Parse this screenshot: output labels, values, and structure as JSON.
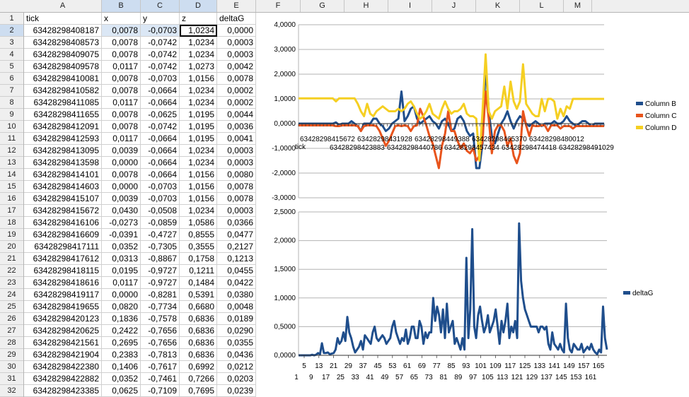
{
  "columns": [
    "A",
    "B",
    "C",
    "D",
    "E",
    "F",
    "G",
    "H",
    "I",
    "J",
    "K",
    "L",
    "M"
  ],
  "header_row": [
    "tick",
    "x",
    "y",
    "z",
    "deltaG"
  ],
  "rows": [
    [
      "63428298408187",
      "0,0078",
      "-0,0703",
      "1,0234",
      "0,0000"
    ],
    [
      "63428298408573",
      "0,0078",
      "-0,0742",
      "1,0234",
      "0,0003"
    ],
    [
      "63428298409075",
      "0,0078",
      "-0,0742",
      "1,0234",
      "0,0003"
    ],
    [
      "63428298409578",
      "0,0117",
      "-0,0742",
      "1,0273",
      "0,0042"
    ],
    [
      "63428298410081",
      "0,0078",
      "-0,0703",
      "1,0156",
      "0,0078"
    ],
    [
      "63428298410582",
      "0,0078",
      "-0,0664",
      "1,0234",
      "0,0002"
    ],
    [
      "63428298411085",
      "0,0117",
      "-0,0664",
      "1,0234",
      "0,0002"
    ],
    [
      "63428298411655",
      "0,0078",
      "-0,0625",
      "1,0195",
      "0,0044"
    ],
    [
      "63428298412091",
      "0,0078",
      "-0,0742",
      "1,0195",
      "0,0036"
    ],
    [
      "63428298412593",
      "0,0117",
      "-0,0664",
      "1,0195",
      "0,0041"
    ],
    [
      "63428298413095",
      "0,0039",
      "-0,0664",
      "1,0234",
      "0,0003"
    ],
    [
      "63428298413598",
      "0,0000",
      "-0,0664",
      "1,0234",
      "0,0003"
    ],
    [
      "63428298414101",
      "0,0078",
      "-0,0664",
      "1,0156",
      "0,0080"
    ],
    [
      "63428298414603",
      "0,0000",
      "-0,0703",
      "1,0156",
      "0,0078"
    ],
    [
      "63428298415107",
      "0,0039",
      "-0,0703",
      "1,0156",
      "0,0078"
    ],
    [
      "63428298415672",
      "0,0430",
      "-0,0508",
      "1,0234",
      "0,0003"
    ],
    [
      "63428298416106",
      "-0,0273",
      "-0,0859",
      "1,0586",
      "0,0366"
    ],
    [
      "63428298416609",
      "-0,0391",
      "-0,4727",
      "0,8555",
      "0,0477"
    ],
    [
      "63428298417111",
      "0,0352",
      "-0,7305",
      "0,3555",
      "0,2127"
    ],
    [
      "63428298417612",
      "0,0313",
      "-0,8867",
      "0,1758",
      "0,1213"
    ],
    [
      "63428298418115",
      "0,0195",
      "-0,9727",
      "0,1211",
      "0,0455"
    ],
    [
      "63428298418616",
      "0,0117",
      "-0,9727",
      "0,1484",
      "0,0422"
    ],
    [
      "63428298419117",
      "0,0000",
      "-0,8281",
      "0,5391",
      "0,0380"
    ],
    [
      "63428298419655",
      "0,0820",
      "-0,7734",
      "0,6680",
      "0,0048"
    ],
    [
      "63428298420123",
      "0,1836",
      "-0,7578",
      "0,6836",
      "0,0189"
    ],
    [
      "63428298420625",
      "0,2422",
      "-0,7656",
      "0,6836",
      "0,0290"
    ],
    [
      "63428298421561",
      "0,2695",
      "-0,7656",
      "0,6836",
      "0,0355"
    ],
    [
      "63428298421904",
      "0,2383",
      "-0,7813",
      "0,6836",
      "0,0436"
    ],
    [
      "63428298422380",
      "0,1406",
      "-0,7617",
      "0,6992",
      "0,0212"
    ],
    [
      "63428298422882",
      "0,0352",
      "-0,7461",
      "0,7266",
      "0,0203"
    ],
    [
      "63428298423385",
      "0,0625",
      "-0,7109",
      "0,7695",
      "0,0239"
    ]
  ],
  "chart_data": [
    {
      "type": "line",
      "ylim": [
        -3,
        4
      ],
      "yticks": [
        "4,0000",
        "3,0000",
        "2,0000",
        "1,0000",
        "0,0000",
        "-1,0000",
        "-2,0000",
        "-3,0000"
      ],
      "xlabel": "tick",
      "xticks_row1": [
        "63428298415672",
        "63428298431928",
        "63428298449388",
        "63428298465370",
        "63428298480012"
      ],
      "xticks_row2": [
        "63428298423883",
        "63428298440786",
        "63428298457434",
        "63428298474418",
        "63428298491029"
      ],
      "legend_position": "right",
      "series": [
        {
          "name": "Column B",
          "color": "#1f4e8c",
          "values": [
            0,
            0,
            0,
            0,
            0,
            0,
            0,
            0,
            0,
            0,
            0,
            0,
            0.05,
            -0.05,
            0,
            0,
            0,
            0.1,
            0,
            -0.1,
            -0.3,
            0,
            0,
            0,
            0.2,
            0.2,
            0,
            -0.1,
            -0.3,
            -0.2,
            0,
            0.1,
            0.2,
            1.3,
            0.1,
            0.3,
            0.6,
            0.7,
            0.2,
            0,
            0.1,
            0.2,
            0.3,
            0.1,
            0,
            -0.2,
            0.1,
            0.2,
            0,
            -0.3,
            -0.2,
            0.2,
            0.3,
            0.1,
            -0.3,
            -0.5,
            -0.4,
            -1.8,
            -1.8,
            -0.8,
            2.4,
            0.5,
            -0.5,
            -0.8,
            -0.4,
            0,
            0.2,
            0.5,
            0.1,
            -0.2,
            0.1,
            0.3,
            0.2,
            0,
            -0.1,
            0,
            0.1,
            0,
            -0.1,
            0,
            0,
            0,
            0.1,
            0,
            0,
            0.1,
            0.3,
            0.1,
            0,
            -0.1,
            0,
            0.1,
            0.1,
            0,
            -0.1,
            0,
            0,
            0,
            0
          ]
        },
        {
          "name": "Column C",
          "color": "#e8541c",
          "values": [
            -0.07,
            -0.07,
            -0.07,
            -0.07,
            -0.07,
            -0.07,
            -0.07,
            -0.07,
            -0.07,
            -0.07,
            -0.07,
            -0.07,
            -0.1,
            -0.1,
            -0.07,
            -0.07,
            -0.07,
            -0.07,
            -0.07,
            -0.1,
            -0.3,
            -0.1,
            -0.07,
            -0.07,
            -0.07,
            -0.1,
            -0.3,
            -0.6,
            -0.9,
            -0.7,
            -0.4,
            -0.1,
            -0.07,
            -0.1,
            -0.07,
            -0.1,
            -0.3,
            -0.1,
            -0.07,
            0.6,
            0.3,
            -0.07,
            -0.5,
            -0.8,
            -1.3,
            -1.8,
            -0.9,
            -0.4,
            0.5,
            -0.3,
            -0.3,
            -0.7,
            -1.0,
            -0.8,
            -1.1,
            -1.2,
            -1.0,
            -1.5,
            -1.3,
            -0.7,
            1.3,
            0.2,
            -1.2,
            -0.3,
            -0.07,
            -0.07,
            -0.3,
            -0.9,
            -0.6,
            -1.3,
            -1.6,
            -1.2,
            0.5,
            -0.07,
            -0.5,
            -0.07,
            -0.1,
            -0.1,
            -0.07,
            -0.07,
            -0.3,
            -0.07,
            -0.07,
            -0.07,
            -0.2,
            -0.1,
            -0.1,
            -0.1,
            -0.2,
            -0.1,
            -0.1,
            -0.1,
            -0.1,
            -0.1,
            -0.1,
            -0.1,
            -0.1,
            -0.1,
            -0.1
          ]
        },
        {
          "name": "Column D",
          "color": "#f5cf22",
          "values": [
            1.02,
            1.02,
            1.02,
            1.02,
            1.02,
            1.02,
            1.02,
            1.02,
            1.02,
            1.02,
            1.02,
            1.02,
            0.9,
            1.02,
            1.02,
            1.02,
            1.02,
            1.02,
            1.02,
            0.8,
            0.5,
            0.3,
            0.8,
            0.4,
            0.3,
            0.5,
            0.6,
            0.7,
            0.6,
            0.5,
            0.5,
            0.5,
            0.6,
            0.5,
            0.6,
            0.8,
            0.9,
            0.7,
            0.4,
            0.2,
            0.3,
            0.5,
            0.8,
            0.4,
            0.3,
            0.2,
            0.6,
            0.9,
            0.6,
            0.4,
            0.5,
            0.5,
            0.6,
            0.8,
            0.4,
            0.3,
            0.3,
            0.2,
            -1.5,
            0.5,
            2.8,
            0.5,
            0.2,
            0.5,
            0.6,
            0.7,
            1.5,
            0.6,
            1.7,
            0.9,
            0.6,
            0.9,
            2.4,
            0.8,
            0.6,
            0.4,
            0.3,
            0.3,
            1.0,
            0.5,
            1.0,
            1.0,
            0.9,
            0.2,
            0.6,
            0.3,
            0.7,
            0.6,
            1.0,
            1.0,
            1.0,
            1.0,
            1.0,
            1.0,
            1.0,
            1.0,
            1.0,
            1.0,
            1.0
          ]
        }
      ]
    },
    {
      "type": "line",
      "ylim": [
        0,
        2.5
      ],
      "yticks": [
        "2,5000",
        "2,0000",
        "1,5000",
        "1,0000",
        "0,5000",
        "0,0000"
      ],
      "xticks_row1": [
        "5",
        "13",
        "21",
        "29",
        "37",
        "45",
        "53",
        "61",
        "69",
        "77",
        "85",
        "93",
        "101",
        "109",
        "117",
        "125",
        "133",
        "141",
        "149",
        "157",
        "165"
      ],
      "xticks_row2": [
        "1",
        "9",
        "17",
        "25",
        "33",
        "41",
        "49",
        "57",
        "65",
        "73",
        "81",
        "89",
        "97",
        "105",
        "113",
        "121",
        "129",
        "137",
        "145",
        "153",
        "161"
      ],
      "legend_position": "right",
      "series": [
        {
          "name": "deltaG",
          "color": "#1f4e8c",
          "values": [
            0,
            0,
            0,
            0,
            0,
            0,
            0,
            0.01,
            0,
            0.01,
            0.04,
            0.02,
            0.21,
            0.04,
            0.04,
            0.05,
            0.02,
            0.03,
            0.04,
            0.1,
            0.3,
            0.2,
            0.25,
            0.4,
            0.25,
            0.67,
            0.4,
            0.3,
            0.15,
            0.05,
            0.1,
            0.15,
            0.25,
            0.1,
            0.35,
            0.3,
            0.25,
            0.2,
            0.4,
            0.5,
            0.3,
            0.25,
            0.3,
            0.35,
            0.3,
            0.2,
            0.25,
            0.3,
            0.5,
            0.6,
            0.4,
            0.3,
            0.2,
            0.3,
            0.25,
            0.45,
            0.2,
            0.3,
            0.5,
            0.5,
            0.3,
            0.3,
            0.6,
            0.5,
            0.2,
            0.4,
            0.3,
            0.4,
            0.4,
            1.0,
            0.6,
            0.85,
            0.7,
            0.4,
            0.8,
            0.3,
            0.9,
            0.4,
            0.5,
            0.6,
            0.2,
            0.3,
            0.2,
            0.1,
            0.3,
            0.1,
            1.7,
            0.3,
            0.8,
            2.2,
            0.5,
            0.3,
            0.7,
            0.85,
            0.6,
            0.4,
            0.5,
            0.7,
            0.4,
            0.5,
            0.6,
            0.8,
            0.5,
            0.2,
            0.6,
            0.4,
            0.6,
            0.9,
            0.3,
            0.5,
            0.4,
            0.6,
            0.3,
            2.3,
            1.3,
            1.0,
            0.8,
            0.7,
            0.6,
            0.5,
            0.5,
            0.5,
            0.5,
            0.4,
            0.5,
            0.5,
            0.45,
            0.5,
            0.2,
            0.1,
            0.4,
            0.2,
            0.15,
            0.1,
            0.2,
            0.1,
            0.05,
            0.9,
            0.3,
            0.1,
            0.05,
            0.2,
            0.15,
            0.1,
            0.1,
            0.2,
            0.05,
            0.1,
            0.15,
            0.1,
            0.2,
            0.1,
            0.05,
            0.02,
            0.1,
            0.05,
            0.85,
            0.3,
            0.1
          ]
        }
      ]
    }
  ]
}
